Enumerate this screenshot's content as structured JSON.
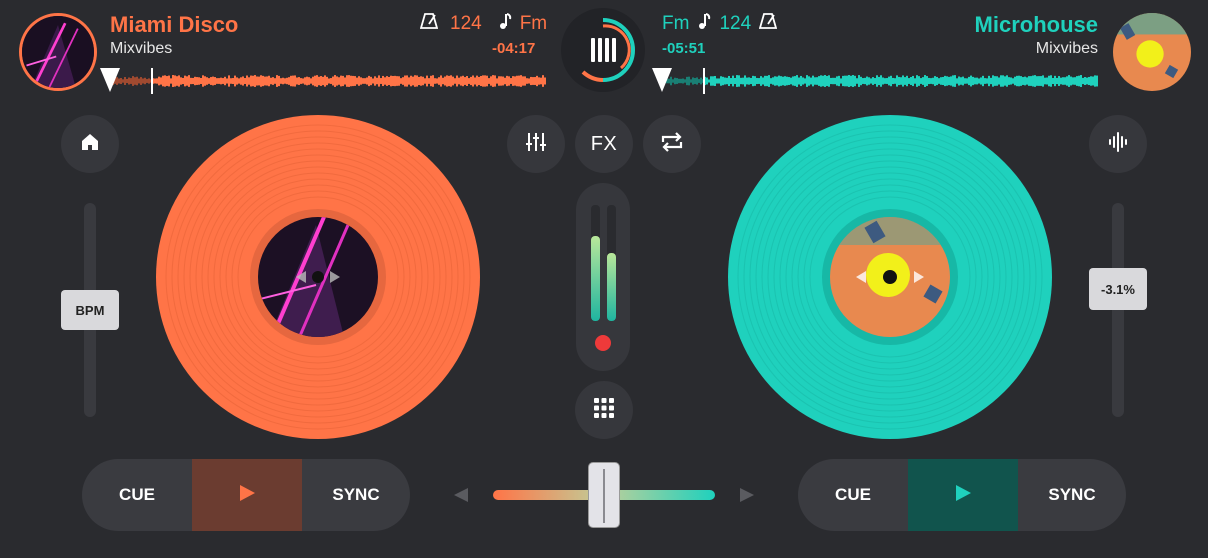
{
  "left_deck": {
    "title": "Miami Disco",
    "artist": "Mixvibes",
    "bpm": "124",
    "key": "Fm",
    "time_remaining": "-04:17",
    "color": "#ff7447",
    "pitch_label": "BPM",
    "cue_label": "CUE",
    "sync_label": "SYNC"
  },
  "right_deck": {
    "title": "Microhouse",
    "artist": "Mixvibes",
    "bpm": "124",
    "key": "Fm",
    "time_remaining": "-05:51",
    "color": "#1fd1bd",
    "pitch_label": "-3.1%",
    "cue_label": "CUE",
    "sync_label": "SYNC"
  },
  "center": {
    "fx_label": "FX"
  },
  "icons": [
    "home-icon",
    "mixer-icon",
    "loop-icon",
    "waveform-icon",
    "grid-icon",
    "play-icon",
    "metronome-icon",
    "music-note-icon"
  ]
}
